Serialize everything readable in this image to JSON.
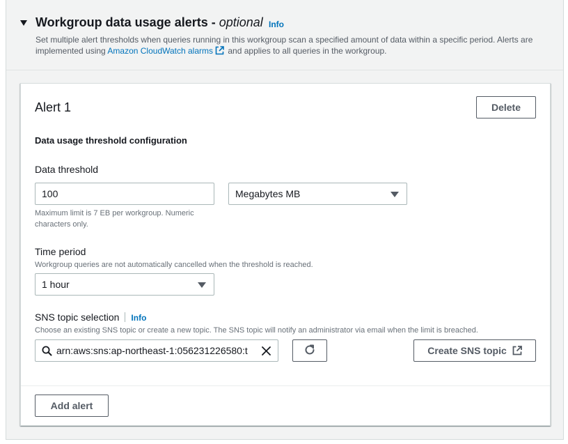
{
  "section": {
    "title_main": "Workgroup data usage alerts - ",
    "title_optional": "optional",
    "info": "Info",
    "description_part1": "Set multiple alert thresholds when queries running in this workgroup scan a specified amount of data within a specific period. Alerts are implemented using ",
    "description_link": "Amazon CloudWatch alarms",
    "description_part2": " and applies to all queries in the workgroup."
  },
  "alert": {
    "title": "Alert 1",
    "delete_label": "Delete",
    "config_title": "Data usage threshold configuration",
    "threshold": {
      "label": "Data threshold",
      "value": "100",
      "unit_value": "Megabytes MB",
      "help": "Maximum limit is 7 EB per workgroup. Numeric characters only."
    },
    "time_period": {
      "label": "Time period",
      "help": "Workgroup queries are not automatically cancelled when the threshold is reached.",
      "value": "1 hour"
    },
    "sns": {
      "label": "SNS topic selection",
      "info": "Info",
      "help": "Choose an existing SNS topic or create a new topic. The SNS topic will notify an administrator via email when the limit is breached.",
      "value": "arn:aws:sns:ap-northeast-1:056231226580:t",
      "create_label": "Create SNS topic"
    }
  },
  "add_alert_label": "Add alert",
  "colors": {
    "link": "#0073bb",
    "text": "#16191f",
    "muted": "#545b64",
    "panel": "#f2f3f3"
  }
}
